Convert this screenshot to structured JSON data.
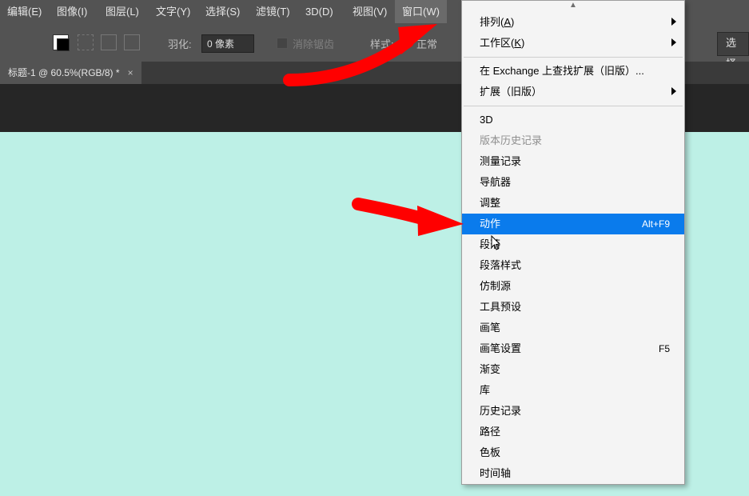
{
  "menubar": {
    "items": [
      "编辑(E)",
      "图像(I)",
      "图层(L)",
      "文字(Y)",
      "选择(S)",
      "滤镜(T)",
      "3D(D)",
      "视图(V)",
      "窗口(W)"
    ]
  },
  "optbar": {
    "feather_label": "羽化:",
    "feather_value": "0 像素",
    "antialias": "消除锯齿",
    "style_label": "样式:",
    "style_value": "正常",
    "select_btn": "选择"
  },
  "tab": {
    "title": "标题-1 @ 60.5%(RGB/8) *",
    "close": "×"
  },
  "dd_scroll": "▲",
  "dropdown": [
    {
      "label": "排列",
      "accel": "A",
      "sub": true
    },
    {
      "label": "工作区",
      "accel": "K",
      "sub": true
    },
    {
      "sep": true
    },
    {
      "label": "在 Exchange 上查找扩展（旧版）..."
    },
    {
      "label": "扩展（旧版）",
      "sub": true
    },
    {
      "sep": true
    },
    {
      "label": "3D"
    },
    {
      "label": "版本历史记录",
      "disabled": true
    },
    {
      "label": "测量记录"
    },
    {
      "label": "导航器"
    },
    {
      "label": "调整"
    },
    {
      "label": "动作",
      "shortcut": "Alt+F9",
      "hl": true
    },
    {
      "label": "段落"
    },
    {
      "label": "段落样式"
    },
    {
      "label": "仿制源"
    },
    {
      "label": "工具预设"
    },
    {
      "label": "画笔"
    },
    {
      "label": "画笔设置",
      "shortcut": "F5"
    },
    {
      "label": "渐变"
    },
    {
      "label": "库"
    },
    {
      "label": "历史记录"
    },
    {
      "label": "路径"
    },
    {
      "label": "色板"
    },
    {
      "label": "时间轴"
    }
  ]
}
